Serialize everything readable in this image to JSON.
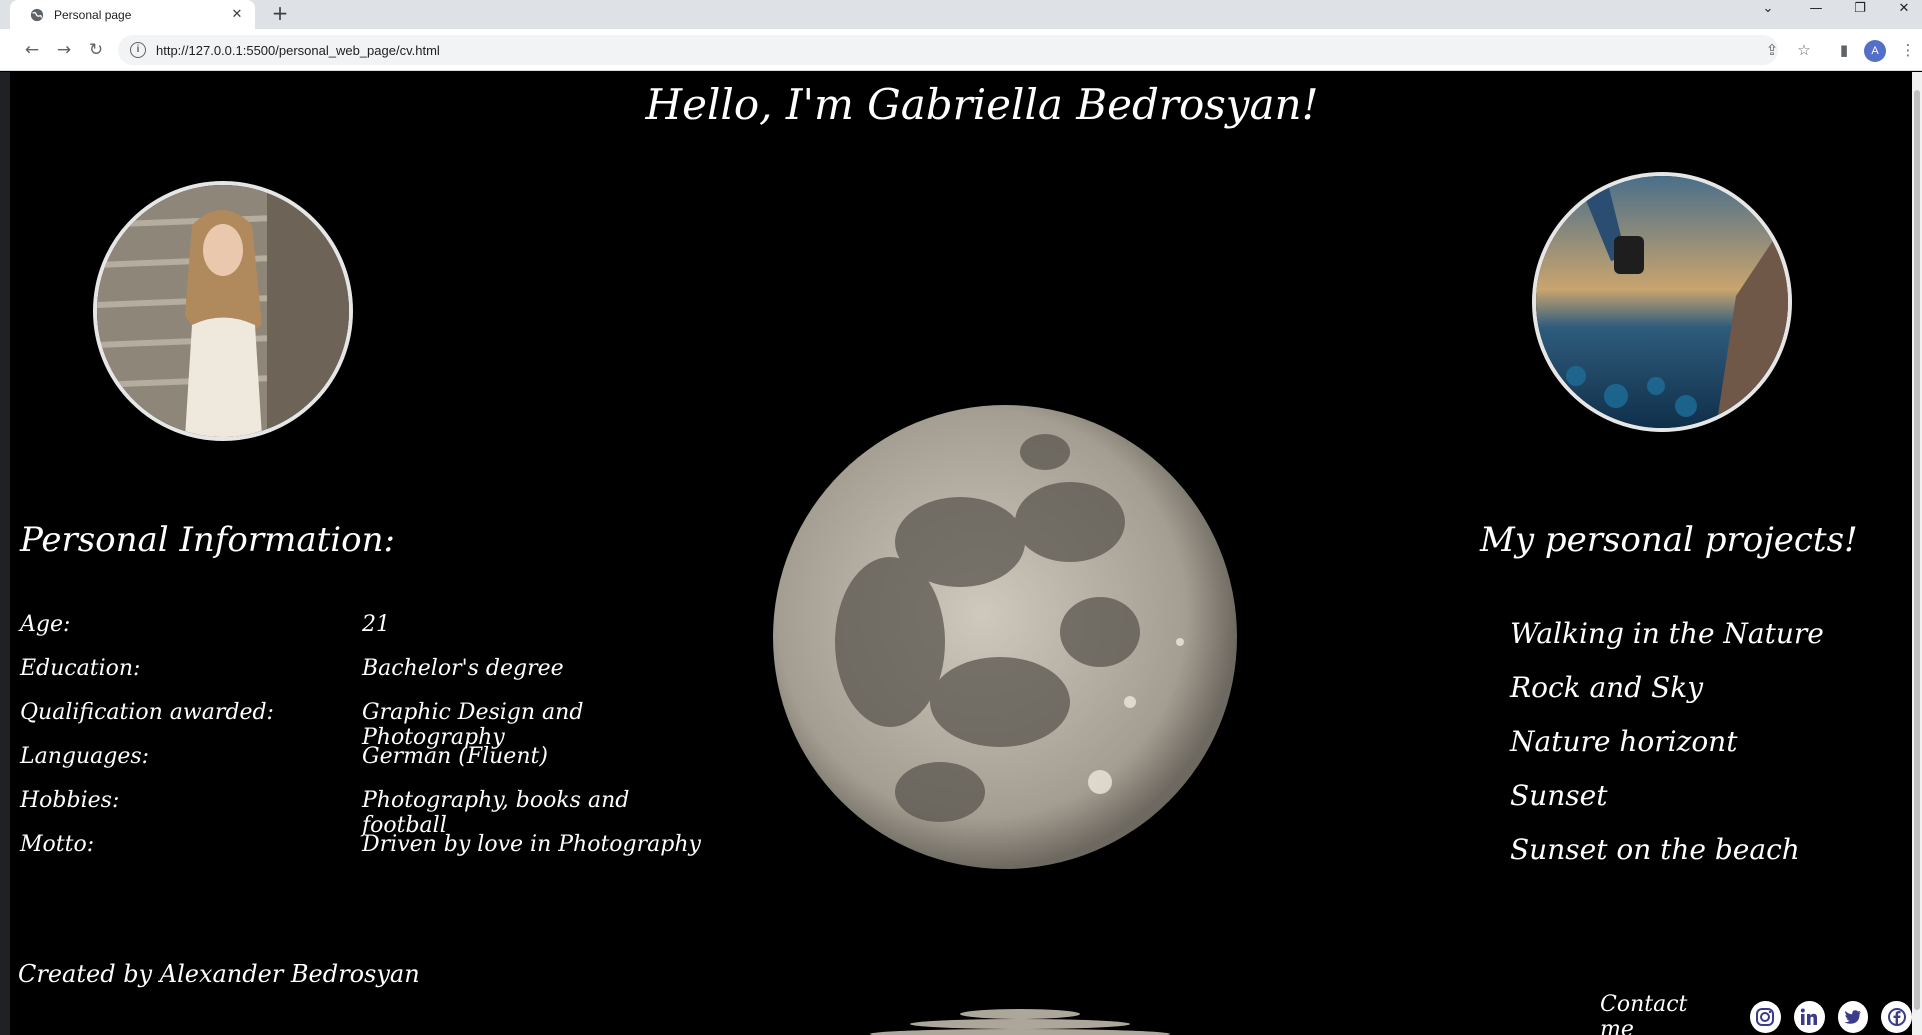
{
  "browser": {
    "tab_title": "Personal page",
    "tab_close": "✕",
    "new_tab": "+",
    "url": "http://127.0.0.1:5500/personal_web_page/cv.html",
    "profile_initial": "A"
  },
  "page": {
    "title": "Hello, I'm Gabriella Bedrosyan!",
    "personal_info": {
      "heading": "Personal Information:",
      "rows": [
        {
          "label": "Age:",
          "value": "21"
        },
        {
          "label": "Education:",
          "value": "Bachelor's degree"
        },
        {
          "label": "Qualification awarded:",
          "value": "Graphic Design and Photography"
        },
        {
          "label": "Languages:",
          "value": "German (Fluent)"
        },
        {
          "label": "Hobbies:",
          "value": "Photography, books and football"
        },
        {
          "label": "Motto:",
          "value": "Driven by love in Photography"
        }
      ]
    },
    "projects": {
      "heading": "My personal projects!",
      "items": [
        "Walking in the Nature",
        "Rock and Sky",
        "Nature horizont",
        "Sunset",
        "Sunset on the beach"
      ]
    },
    "credit": "Created by Alexander Bedrosyan",
    "contact": {
      "label": "Contact me",
      "icons": [
        "instagram-icon",
        "linkedin-icon",
        "twitter-icon",
        "facebook-icon"
      ]
    }
  },
  "colors": {
    "background": "#000000",
    "text": "#ffffff",
    "social_icon_bg": "#ffffff",
    "social_icon_fg": "#3b3b8c"
  }
}
